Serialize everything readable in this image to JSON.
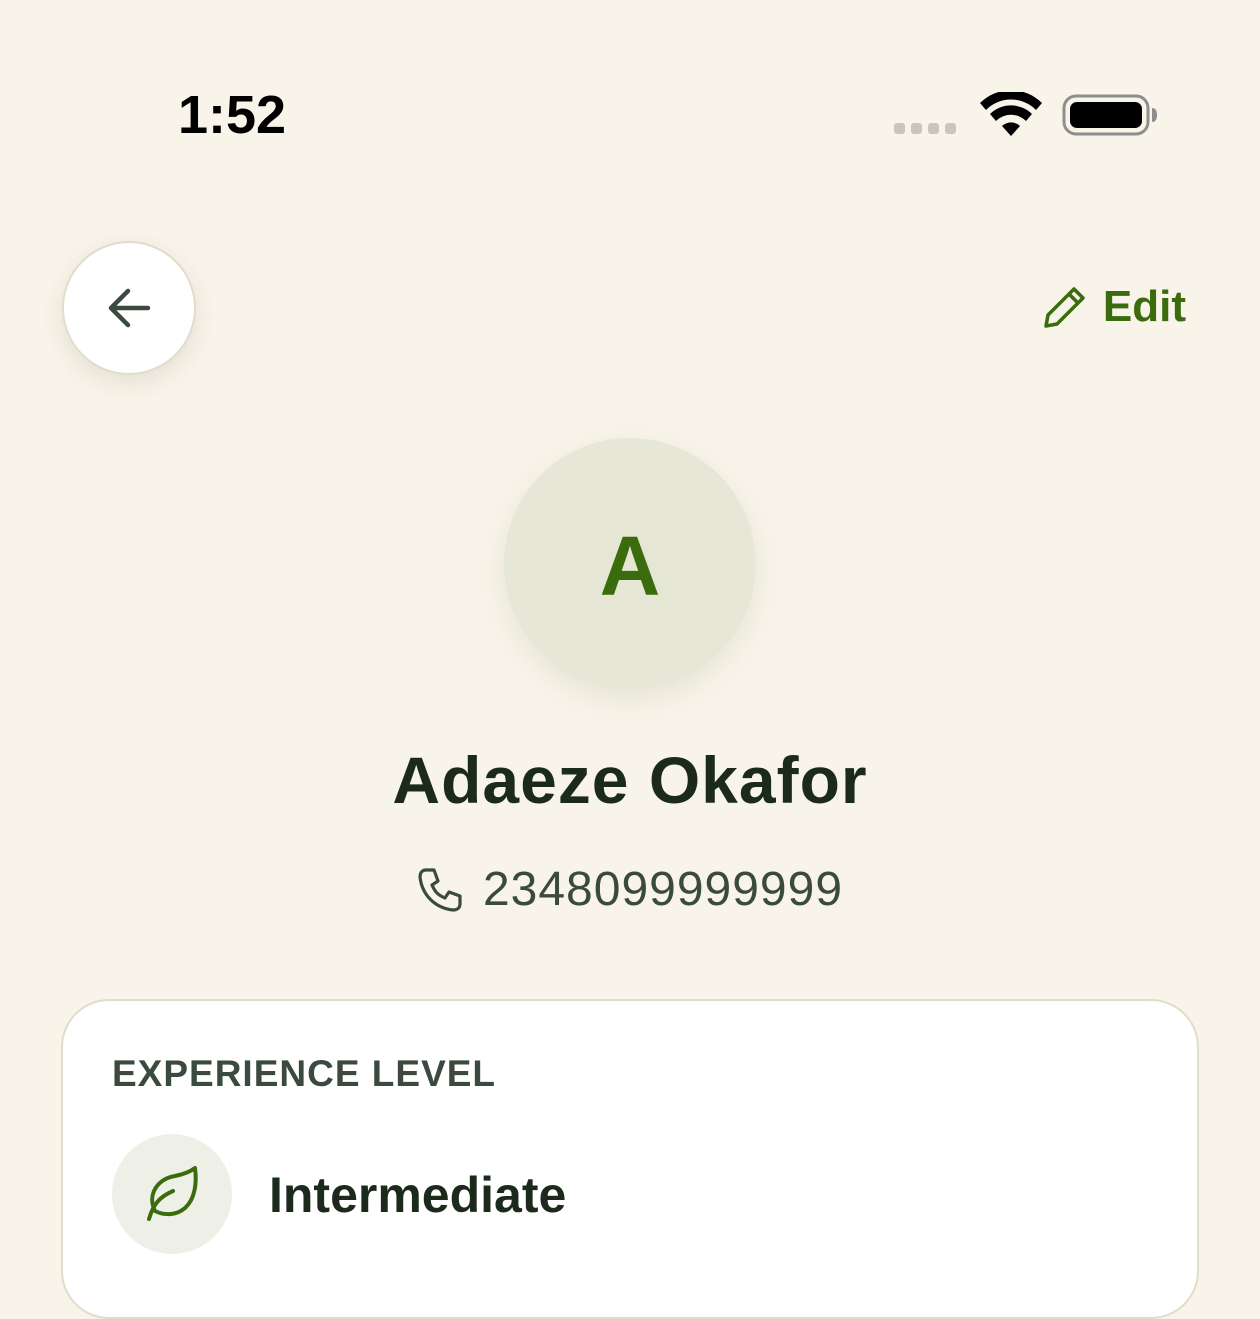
{
  "status_bar": {
    "time": "1:52",
    "wifi_icon": "wifi-icon",
    "battery_icon": "battery-icon"
  },
  "header": {
    "back_icon": "arrow-left-icon",
    "edit_label": "Edit",
    "edit_icon": "pencil-icon"
  },
  "profile": {
    "initial": "A",
    "name": "Adaeze Okafor",
    "phone_icon": "phone-icon",
    "phone": "2348099999999"
  },
  "experience_card": {
    "label": "EXPERIENCE LEVEL",
    "icon": "leaf-icon",
    "value": "Intermediate"
  },
  "colors": {
    "background": "#f8f4ea",
    "accent": "#3a6b0c",
    "text_primary": "#1c2a1c",
    "text_secondary": "#3b4a3e",
    "card_background": "#ffffff",
    "avatar_background": "#e6e7d6"
  }
}
